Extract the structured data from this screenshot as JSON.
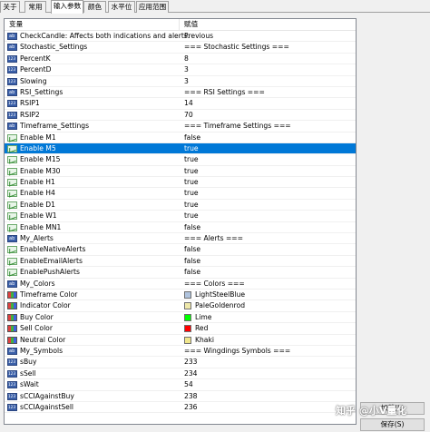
{
  "tabs": [
    {
      "label": "关于",
      "active": false
    },
    {
      "label": "常用",
      "active": false
    },
    {
      "label": "输入参数",
      "active": true
    },
    {
      "label": "颜色",
      "active": false
    },
    {
      "label": "水平位",
      "active": false
    },
    {
      "label": "应用范围",
      "active": false
    }
  ],
  "table": {
    "headers": {
      "variable": "变量",
      "value": "赋值"
    },
    "rows": [
      {
        "icon": "text-param-icon",
        "name": "CheckCandle: Affects both indications and alerts.",
        "value": "Previous"
      },
      {
        "icon": "text-param-icon",
        "name": "Stochastic_Settings",
        "value": "=== Stochastic Settings ==="
      },
      {
        "icon": "int-param-icon",
        "name": "PercentK",
        "value": "8"
      },
      {
        "icon": "int-param-icon",
        "name": "PercentD",
        "value": "3"
      },
      {
        "icon": "int-param-icon",
        "name": "Slowing",
        "value": "3"
      },
      {
        "icon": "text-param-icon",
        "name": "RSI_Settings",
        "value": "=== RSI Settings ==="
      },
      {
        "icon": "int-param-icon",
        "name": "RSIP1",
        "value": "14"
      },
      {
        "icon": "int-param-icon",
        "name": "RSIP2",
        "value": "70"
      },
      {
        "icon": "text-param-icon",
        "name": "Timeframe_Settings",
        "value": "=== Timeframe Settings ==="
      },
      {
        "icon": "bool-param-icon",
        "name": "Enable M1",
        "value": "false"
      },
      {
        "icon": "bool-param-icon",
        "name": "Enable M5",
        "value": "true",
        "selected": true
      },
      {
        "icon": "bool-param-icon",
        "name": "Enable M15",
        "value": "true"
      },
      {
        "icon": "bool-param-icon",
        "name": "Enable M30",
        "value": "true"
      },
      {
        "icon": "bool-param-icon",
        "name": "Enable H1",
        "value": "true"
      },
      {
        "icon": "bool-param-icon",
        "name": "Enable H4",
        "value": "true"
      },
      {
        "icon": "bool-param-icon",
        "name": "Enable D1",
        "value": "true"
      },
      {
        "icon": "bool-param-icon",
        "name": "Enable W1",
        "value": "true"
      },
      {
        "icon": "bool-param-icon",
        "name": "Enable MN1",
        "value": "false"
      },
      {
        "icon": "text-param-icon",
        "name": "My_Alerts",
        "value": "=== Alerts ==="
      },
      {
        "icon": "bool-param-icon",
        "name": "EnableNativeAlerts",
        "value": "false"
      },
      {
        "icon": "bool-param-icon",
        "name": "EnableEmailAlerts",
        "value": "false"
      },
      {
        "icon": "bool-param-icon",
        "name": "EnablePushAlerts",
        "value": "false"
      },
      {
        "icon": "text-param-icon",
        "name": "My_Colors",
        "value": "=== Colors ==="
      },
      {
        "icon": "color-param-icon",
        "name": "Timeframe Color",
        "value": "LightSteelBlue",
        "swatch": "#b0c4de"
      },
      {
        "icon": "color-param-icon",
        "name": "Indicator Color",
        "value": "PaleGoldenrod",
        "swatch": "#eee8aa"
      },
      {
        "icon": "color-param-icon",
        "name": "Buy Color",
        "value": "Lime",
        "swatch": "#00ff00"
      },
      {
        "icon": "color-param-icon",
        "name": "Sell Color",
        "value": "Red",
        "swatch": "#ff0000"
      },
      {
        "icon": "color-param-icon",
        "name": "Neutral Color",
        "value": "Khaki",
        "swatch": "#f0e68c"
      },
      {
        "icon": "text-param-icon",
        "name": "My_Symbols",
        "value": "=== Wingdings Symbols ==="
      },
      {
        "icon": "int-param-icon",
        "name": "sBuy",
        "value": "233"
      },
      {
        "icon": "int-param-icon",
        "name": "sSell",
        "value": "234"
      },
      {
        "icon": "int-param-icon",
        "name": "sWait",
        "value": "54"
      },
      {
        "icon": "int-param-icon",
        "name": "sCCIAgainstBuy",
        "value": "238"
      },
      {
        "icon": "int-param-icon",
        "name": "sCCIAgainstSell",
        "value": "236"
      }
    ]
  },
  "buttons": {
    "load": "加载(L)",
    "save": "保存(S)"
  },
  "watermark": "知乎 @小V量化",
  "colors": {
    "selection": "#0078d7"
  }
}
